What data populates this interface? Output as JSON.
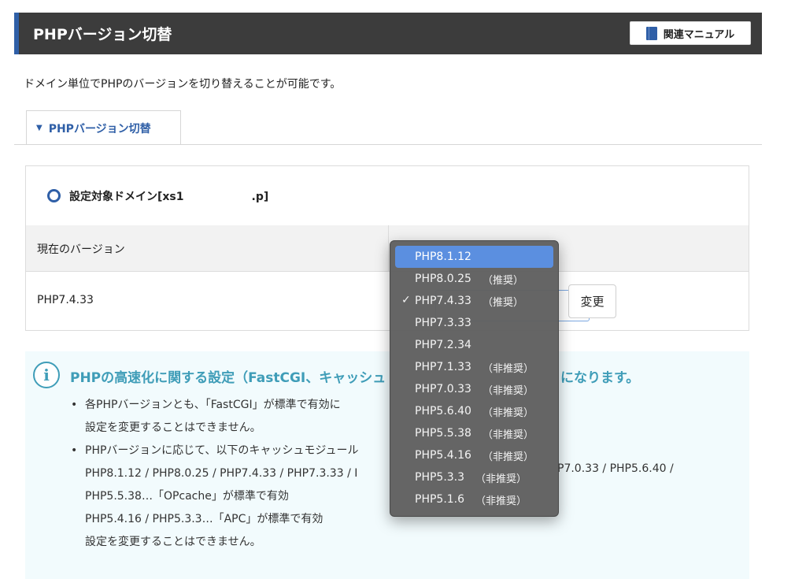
{
  "header": {
    "title": "PHPバージョン切替",
    "manual_label": "関連マニュアル",
    "manual_icon": "book-icon",
    "accent": "#2f5fa7"
  },
  "description": "ドメイン単位でPHPのバージョンを切り替えることが可能です。",
  "tab": {
    "label": "PHPバージョン切替",
    "icon": "chevron-down-icon"
  },
  "panel": {
    "domain_prefix": "設定対象ドメイン[xs1",
    "domain_suffix": ".p]",
    "column_current": "現在のバージョン",
    "current_version": "PHP7.4.33"
  },
  "change_button": "変更",
  "dropdown": {
    "items": [
      {
        "label": "PHP8.1.12",
        "tag": ""
      },
      {
        "label": "PHP8.0.25",
        "tag": "（推奨）"
      },
      {
        "label": "PHP7.4.33",
        "tag": "（推奨）"
      },
      {
        "label": "PHP7.3.33",
        "tag": ""
      },
      {
        "label": "PHP7.2.34",
        "tag": ""
      },
      {
        "label": "PHP7.1.33",
        "tag": "（非推奨）"
      },
      {
        "label": "PHP7.0.33",
        "tag": "（非推奨）"
      },
      {
        "label": "PHP5.6.40",
        "tag": "（非推奨）"
      },
      {
        "label": "PHP5.5.38",
        "tag": "（非推奨）"
      },
      {
        "label": "PHP5.4.16",
        "tag": "（非推奨）"
      },
      {
        "label": "PHP5.3.3",
        "tag": "（非推奨）"
      },
      {
        "label": "PHP5.1.6",
        "tag": "（非推奨）"
      }
    ],
    "highlighted_index": 0,
    "checked_index": 2
  },
  "info": {
    "icon": "info-icon",
    "title": "PHPの高速化に関する設定（FastCGI、キャッシュ",
    "title_right": "になります。",
    "line1": "各PHPバージョンとも、「FastCGI」が標準で有効に",
    "line2": "設定を変更することはできません。",
    "line3": "PHPバージョンに応じて、以下のキャッシュモジュール",
    "line4": "PHP8.1.12 / PHP8.0.25 / PHP7.4.33 / PHP7.3.33 / I",
    "line4_right": "P7.0.33 / PHP5.6.40 /",
    "line5": "PHP5.5.38…「OPcache」が標準で有効",
    "line6": "PHP5.4.16 / PHP5.3.3…「APC」が標準で有効",
    "line7": "設定を変更することはできません。"
  }
}
